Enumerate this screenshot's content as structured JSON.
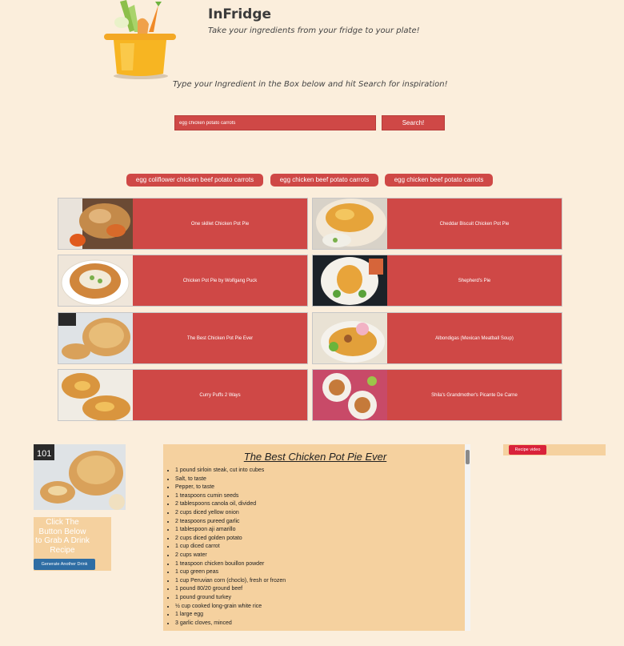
{
  "header": {
    "brand": "InFridge",
    "tagline": "Take your ingredients from your fridge to your plate!",
    "instruction": "Type your Ingredient in the Box below and hit Search for inspiration!"
  },
  "search": {
    "value": "egg chicken potato carrots",
    "button_label": "Search!"
  },
  "history": [
    {
      "label": "egg coliflower chicken beef potato carrots"
    },
    {
      "label": "egg chicken beef potato carrots"
    },
    {
      "label": "egg chicken beef potato carrots"
    }
  ],
  "recipes": [
    {
      "title": "One skillet Chicken Pot Pie"
    },
    {
      "title": "Cheddar Biscuit Chicken Pot Pie"
    },
    {
      "title": "Chicken Pot Pie by Wolfgang Puck"
    },
    {
      "title": "Shepherd's Pie"
    },
    {
      "title": "The Best Chicken Pot Pie Ever"
    },
    {
      "title": "Albondigas (Mexican Meatball Soup)"
    },
    {
      "title": "Curry Puffs 2 Ways"
    },
    {
      "title": "Shila's Grandmother's Picante De Carne"
    }
  ],
  "drink": {
    "image_badge": "101",
    "prompt": "Click The Button Below to Grab A Drink Recipe",
    "button_label": "Generate Another Drink"
  },
  "selected_recipe": {
    "title": "The Best Chicken Pot Pie Ever",
    "ingredients": [
      "1 pound sirloin steak, cut into cubes",
      "Salt, to taste",
      "Pepper, to taste",
      "1 teaspoons cumin seeds",
      "2 tablespoons canola oil, divided",
      "2 cups diced yellow onion",
      "2 teaspoons pureed garlic",
      "1 tablespoon aji amarillo",
      "2 cups diced golden potato",
      "1 cup diced carrot",
      "2 cups water",
      "1 teaspoon chicken bouillon powder",
      "1 cup green peas",
      "1 cup Peruvian corn (choclo), fresh or frozen",
      "1 pound 80/20 ground beef",
      "1 pound ground turkey",
      "½ cup cooked long-grain white rice",
      "1 large egg",
      "3 garlic cloves, minced"
    ]
  },
  "video": {
    "button_label": "Recipe video"
  },
  "colors": {
    "background": "#fbeedc",
    "card_red": "#cf4846",
    "panel_tan": "#f5d19f",
    "drink_button_blue": "#2e6da4",
    "video_button_red": "#d9223a"
  },
  "icons": [
    "fridge-pot-logo",
    "recipe-thumbnails",
    "drink-image"
  ]
}
